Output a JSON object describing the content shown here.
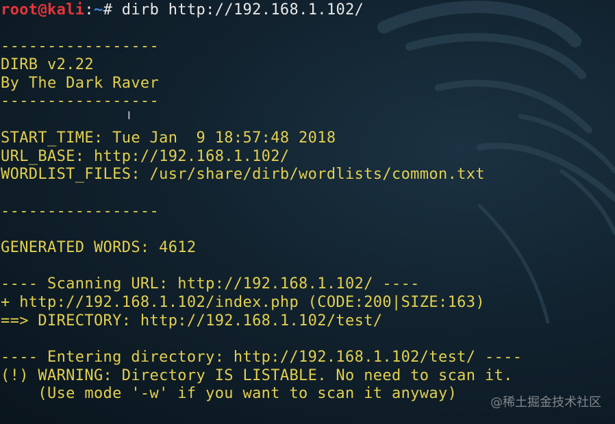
{
  "prompt": {
    "user_host": "root@kali",
    "separator": ":",
    "path": "~",
    "symbol": "#",
    "command": "dirb http://192.168.1.102/"
  },
  "output_lines": [
    "",
    "-----------------",
    "DIRB v2.22",
    "By The Dark Raver",
    "-----------------",
    "",
    "START_TIME: Tue Jan  9 18:57:48 2018",
    "URL_BASE: http://192.168.1.102/",
    "WORDLIST_FILES: /usr/share/dirb/wordlists/common.txt",
    "",
    "-----------------",
    "",
    "GENERATED WORDS: 4612",
    "",
    "---- Scanning URL: http://192.168.1.102/ ----",
    "+ http://192.168.1.102/index.php (CODE:200|SIZE:163)",
    "==> DIRECTORY: http://192.168.1.102/test/",
    "",
    "---- Entering directory: http://192.168.1.102/test/ ----",
    "(!) WARNING: Directory IS LISTABLE. No need to scan it.",
    "    (Use mode '-w' if you want to scan it anyway)"
  ],
  "watermark": "@稀土掘金技术社区",
  "colors": {
    "output_text": "#e3cf50",
    "prompt_user": "#e8343a",
    "prompt_path": "#4a86d8",
    "command_text": "#e8e8e8",
    "background": "#11222e"
  },
  "icons": {
    "background_logo": "kali-dragon-icon",
    "mouse_cursor": "text-cursor-icon"
  }
}
